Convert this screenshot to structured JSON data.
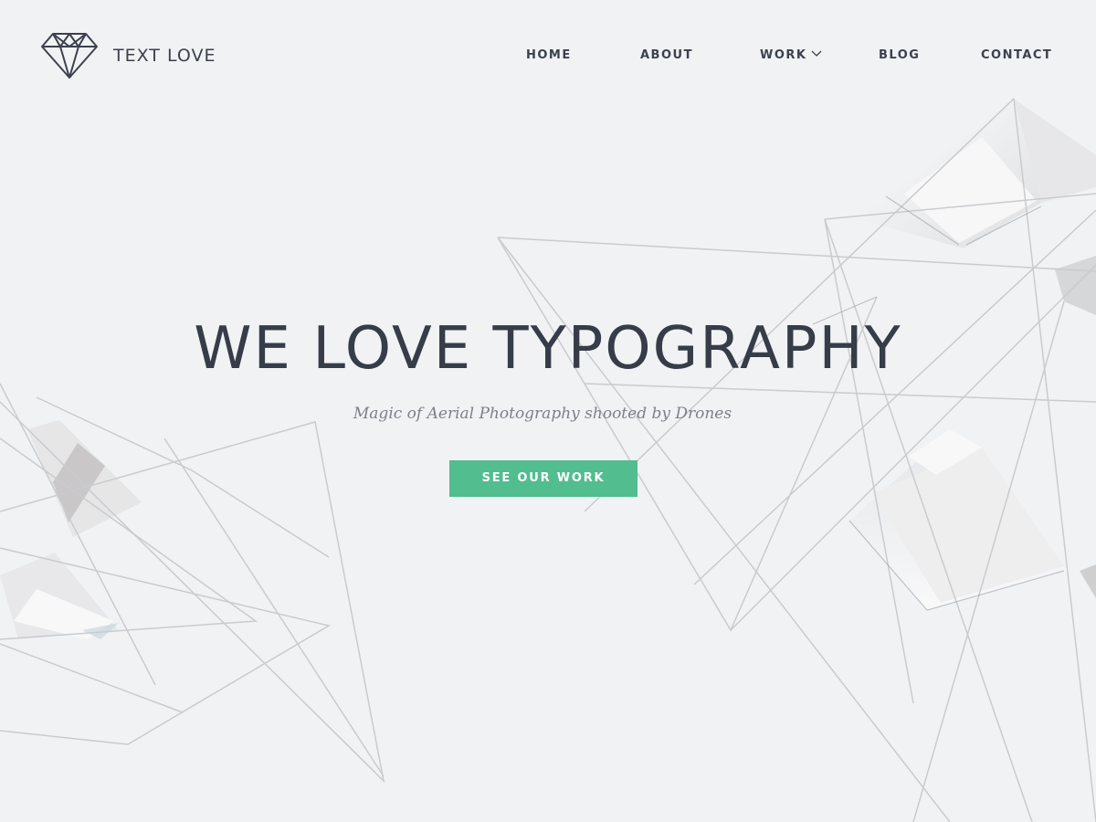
{
  "brand": {
    "name": "TEXT LOVE",
    "icon": "diamond-icon"
  },
  "nav": {
    "items": [
      {
        "label": "HOME"
      },
      {
        "label": "ABOUT"
      },
      {
        "label": "WORK",
        "has_dropdown": true,
        "dropdown_icon": "chevron-down-icon"
      },
      {
        "label": "BLOG"
      },
      {
        "label": "CONTACT"
      }
    ]
  },
  "hero": {
    "title": "WE LOVE TYPOGRAPHY",
    "subtitle": "Magic of Aerial Photography shooted by Drones",
    "cta_label": "SEE OUR WORK"
  },
  "colors": {
    "background": "#f1f2f4",
    "text": "#363c48",
    "subtitle": "#7b808a",
    "accent": "#52bd8f"
  }
}
